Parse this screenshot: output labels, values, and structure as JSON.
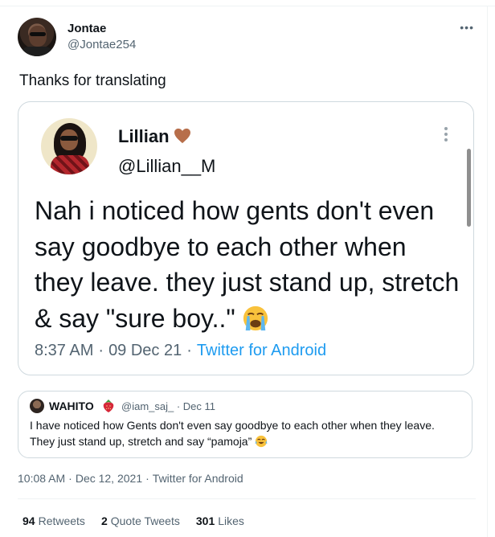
{
  "tweet": {
    "author": {
      "display_name": "Jontae",
      "handle": "@Jontae254"
    },
    "more_icon": "more-horizontal-icon",
    "text": "Thanks for translating",
    "timestamp": {
      "time": "10:08 AM",
      "date": "Dec 12, 2021",
      "source": "Twitter for Android"
    },
    "stats": {
      "retweets_count": "94",
      "retweets_label": "Retweets",
      "quote_count": "2",
      "quote_label": "Quote Tweets",
      "likes_count": "301",
      "likes_label": "Likes"
    }
  },
  "screenshot_card": {
    "author": {
      "display_name": "Lillian",
      "name_emoji": "brown-heart-icon",
      "handle": "@Lillian__M"
    },
    "more_icon": "more-vertical-icon",
    "body": "Nah i noticed how gents don't even say goodbye to each other when they leave. they just stand up, stretch & say \"sure boy..\"",
    "body_emoji": "loudly-crying-face-icon",
    "meta": {
      "time": "8:37 AM",
      "date": "09 Dec 21",
      "source": "Twitter for Android"
    }
  },
  "quote": {
    "author": {
      "display_name": "WAHITO",
      "name_emoji": "strawberry-icon",
      "handle": "@iam_saj_",
      "date": "Dec 11"
    },
    "text": "I have  noticed how Gents don't even say goodbye to each other when they leave. They just stand up,  stretch and say “pamoja”",
    "text_emoji": "face-with-tears-of-joy-icon"
  },
  "colors": {
    "primary_text": "#0f1419",
    "secondary_text": "#536471",
    "link": "#1d9bf0",
    "border": "#cfd9de"
  }
}
